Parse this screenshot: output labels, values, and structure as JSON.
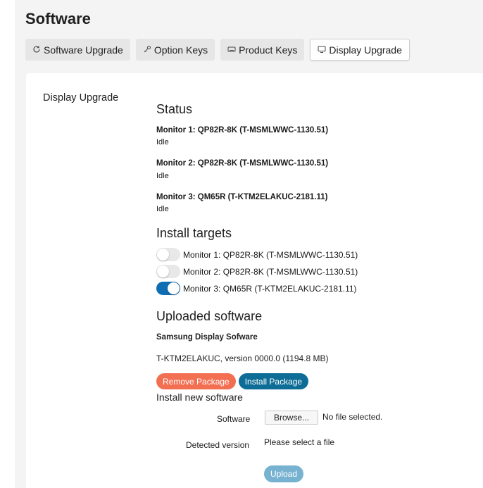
{
  "page": {
    "title": "Software"
  },
  "tabs": [
    {
      "label": "Software Upgrade",
      "icon": "refresh-icon",
      "active": false
    },
    {
      "label": "Option Keys",
      "icon": "key-icon",
      "active": false
    },
    {
      "label": "Product Keys",
      "icon": "keyboard-icon",
      "active": false
    },
    {
      "label": "Display Upgrade",
      "icon": "monitor-icon",
      "active": true
    }
  ],
  "section": {
    "label": "Display Upgrade"
  },
  "status": {
    "heading": "Status",
    "monitors": [
      {
        "title": "Monitor 1: QP82R-8K (T-MSMLWWC-1130.51)",
        "state": "Idle"
      },
      {
        "title": "Monitor 2: QP82R-8K (T-MSMLWWC-1130.51)",
        "state": "Idle"
      },
      {
        "title": "Monitor 3: QM65R (T-KTM2ELAKUC-2181.11)",
        "state": "Idle"
      }
    ]
  },
  "install_targets": {
    "heading": "Install targets",
    "items": [
      {
        "label": "Monitor 1: QP82R-8K (T-MSMLWWC-1130.51)",
        "enabled": false
      },
      {
        "label": "Monitor 2: QP82R-8K (T-MSMLWWC-1130.51)",
        "enabled": false
      },
      {
        "label": "Monitor 3: QM65R (T-KTM2ELAKUC-2181.11)",
        "enabled": true
      }
    ]
  },
  "uploaded": {
    "heading": "Uploaded software",
    "name": "Samsung Display Sofware",
    "version": "T-KTM2ELAKUC, version 0000.0 (1194.8 MB)",
    "remove_label": "Remove Package",
    "install_label": "Install Package"
  },
  "install_new": {
    "heading": "Install new software",
    "software_label": "Software",
    "browse_label": "Browse...",
    "no_file": "No file selected.",
    "detected_label": "Detected version",
    "detected_value": "Please select a file",
    "upload_label": "Upload"
  },
  "colors": {
    "accent": "#0f6eb3",
    "remove": "#f36f52",
    "install": "#0d6d96",
    "upload": "#77b3d1"
  }
}
